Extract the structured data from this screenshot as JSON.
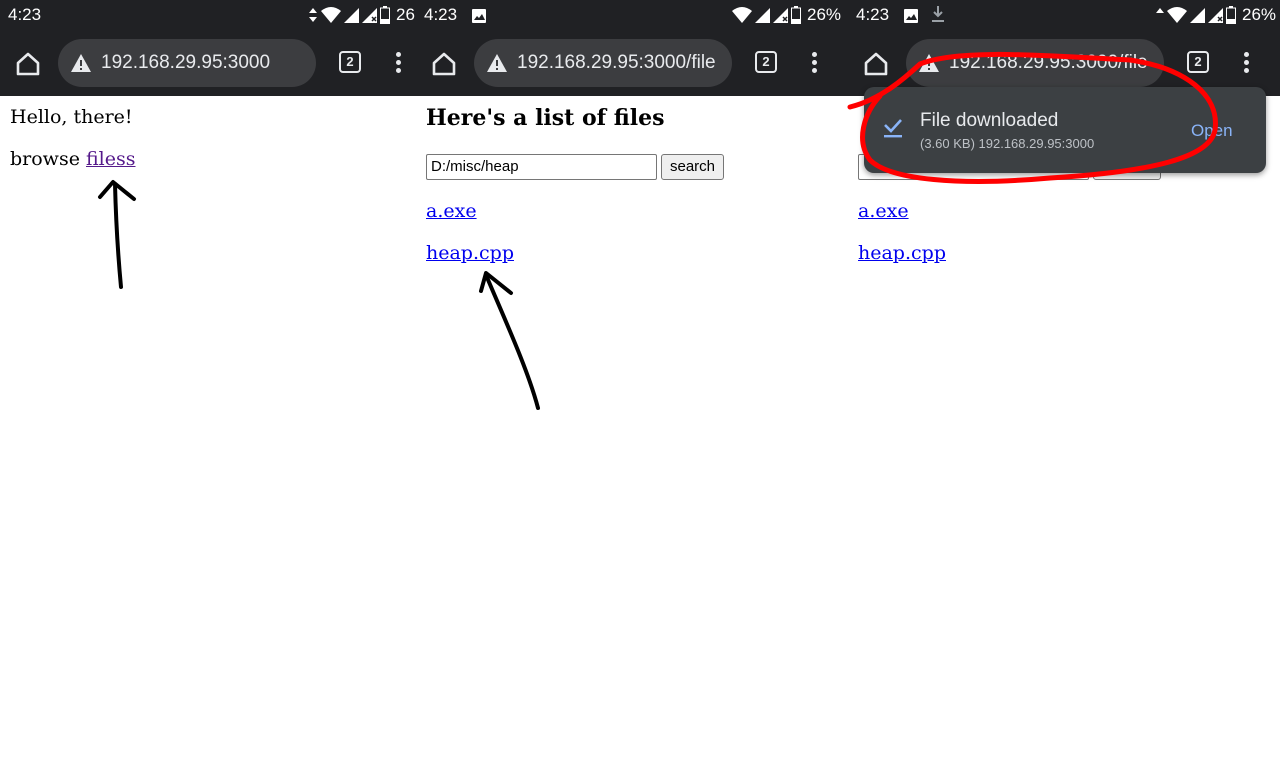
{
  "status_bar": {
    "time": "4:23",
    "battery_partial": "26",
    "battery": "26%"
  },
  "browser": {
    "url_1": "192.168.29.95:3000",
    "url_2": "192.168.29.95:3000/file",
    "tab_count": "2"
  },
  "screen1": {
    "greeting": "Hello, there!",
    "browse_prefix": "browse",
    "files_link": "filess"
  },
  "screen2": {
    "heading": "Here's a list of files",
    "search_value": "D:/misc/heap",
    "search_button": "search",
    "files": [
      "a.exe",
      "heap.cpp"
    ]
  },
  "screen3": {
    "files": [
      "a.exe",
      "heap.cpp"
    ]
  },
  "download_snackbar": {
    "title": "File downloaded",
    "detail": "(3.60 KB) 192.168.29.95:3000",
    "action": "Open"
  },
  "colors": {
    "toolbar": "#202124",
    "omnibox": "#3c3d40",
    "link": "#0000ee",
    "visited_link": "#551a8b",
    "snackbar": "#3c4043",
    "snackbar_action": "#8ab4f8",
    "annotation_red": "#ff0000"
  }
}
